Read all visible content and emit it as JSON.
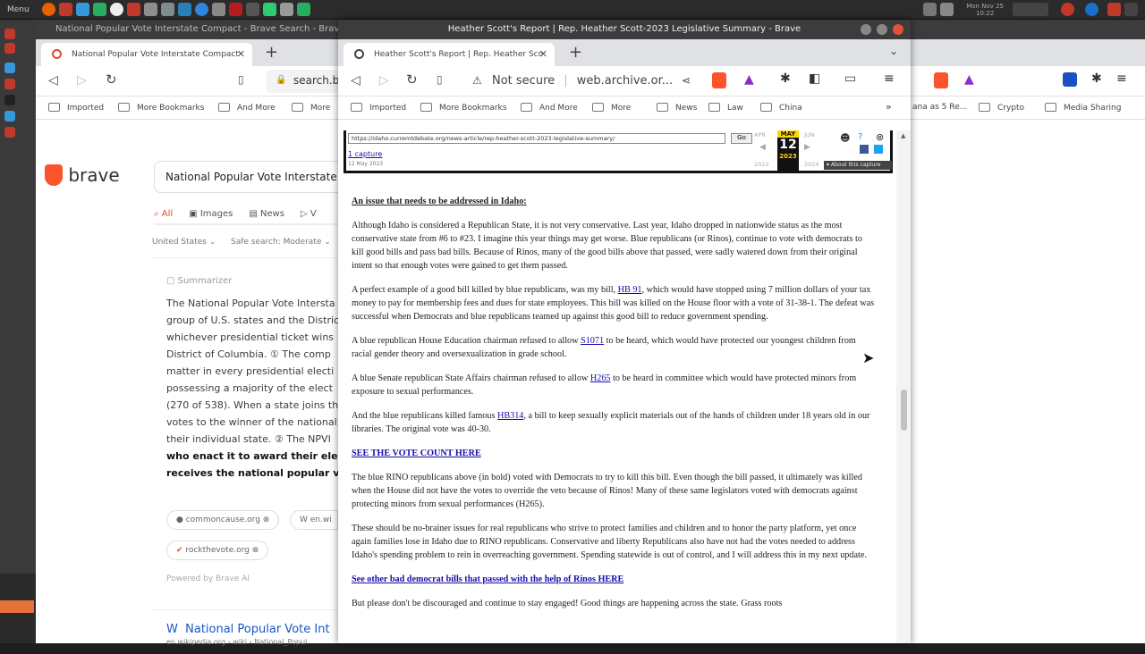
{
  "panel": {
    "menu_label": "Menu",
    "clock_line1": "Mon Nov 25",
    "clock_line2": "10:22"
  },
  "back_window": {
    "title": "National Popular Vote Interstate Compact - Brave Search - Brave",
    "tab_label": "National Popular Vote Interstate Compact",
    "url": "search.b",
    "bookmarks": [
      "Imported",
      "More Bookmarks",
      "And More",
      "More"
    ],
    "right_bookmarks": [
      "ana as 5 Re...",
      "Crypto",
      "Media Sharing"
    ],
    "logo_text": "brave",
    "search_query": "National Popular Vote Interstate Co",
    "filters": {
      "all": "All",
      "images": "Images",
      "news": "News",
      "v": "V"
    },
    "region": "United States",
    "safe_search": "Safe search: Moderate",
    "summarizer_label": "Summarizer",
    "summary": [
      "The National Popular Vote Intersta",
      "group of U.S. states and the Distric",
      "whichever presidential ticket wins",
      "District of Columbia. ① The comp",
      "matter in every presidential electi",
      "possessing a majority of the elect",
      "(270 of 538). When a state joins th",
      "votes to the winner of the national",
      "their individual state. ② The NPVI"
    ],
    "summary_bold": [
      "who enact it to award their electo",
      "receives the national popular vot"
    ],
    "sources": [
      "commoncause.org",
      "en.wi",
      "rockthevote.org"
    ],
    "powered_by": "Powered by Brave AI",
    "result_title": "National Popular Vote Int",
    "result_url": "en.wikipedia.org › wiki › National_Popul"
  },
  "front_window": {
    "title": "Heather Scott's Report | Rep. Heather Scott-2023 Legislative Summary - Brave",
    "tab_label": "Heather Scott's Report | Rep. Heather Sco",
    "not_secure": "Not secure",
    "url": "web.archive.or...",
    "bookmarks": [
      "Imported",
      "More Bookmarks",
      "And More",
      "More",
      "News",
      "Law",
      "China"
    ],
    "wayback": {
      "url_field": "https://idaho.curremtdebate.org/news-article/rep-heather-scott-2023-legislative-summary/",
      "go_label": "Go",
      "captures": "1 capture",
      "capture_date": "12 May 2023",
      "month_prev": "APR",
      "month_cur": "MAY",
      "month_next": "JUN",
      "day": "12",
      "year_prev": "2022",
      "year_cur": "2023",
      "year_next": "2024",
      "about": "▾ About this capture"
    },
    "doc": {
      "heading": "An issue that needs to be addressed in Idaho:",
      "p1": "Although Idaho is considered a Republican State, it is not very conservative. Last year, Idaho dropped in nationwide status as the most conservative state from #6 to #23. I imagine this year things may get worse. Blue republicans (or Rinos), continue to vote with democrats to kill good bills and pass bad bills. Because of Rinos, many of the good bills above that passed, were sadly watered down from their original intent so that enough votes were gained to get them passed.",
      "p2_a": "A perfect example of a good bill killed by blue republicans, was my bill, ",
      "p2_link": "HB 91",
      "p2_b": ", which would have stopped using 7 million dollars of your tax money to pay for membership fees and dues for state employees. This bill was killed on the House floor with a vote of 31-38-1. The defeat was successful when Democrats and blue republicans teamed up against this good bill to reduce government spending.",
      "p3_a": "A blue republican House Education chairman refused to allow ",
      "p3_link": "S1071",
      "p3_b": " to be heard, which would have protected our youngest children from racial gender theory and oversexualization in grade school.",
      "p4_a": "A blue Senate republican State Affairs chairman refused to allow ",
      "p4_link": "H265",
      "p4_b": " to be heard in committee which would have protected minors from exposure to sexual performances.",
      "p5_a": "And the blue republicans killed famous ",
      "p5_link": "HB314",
      "p5_b": ", a bill to keep sexually explicit materials out of the hands of children under 18 years old in our libraries. The original vote was 40-30.",
      "vote_link": "SEE THE VOTE COUNT HERE",
      "p6": "The blue RINO republicans above (in bold) voted with Democrats to try to kill this bill. Even though the bill passed, it ultimately was killed when the House did not have the votes to override the veto because of Rinos! Many of these same legislators voted with democrats against protecting minors from sexual performances (H265).",
      "p7": "These should be no-brainer issues for real republicans who strive to protect families and children and to honor the party platform, yet once again families lose in Idaho due to RINO republicans. Conservative and liberty Republicans also have not had the votes needed to address Idaho's spending problem to rein in overreaching government. Spending statewide is out of control, and I will address this in my next update.",
      "bad_bills_link": "See other bad democrat bills that passed with the help of Rinos HERE",
      "p8": "But please don't be discouraged and continue to stay engaged! Good things are happening across the state. Grass roots"
    }
  }
}
